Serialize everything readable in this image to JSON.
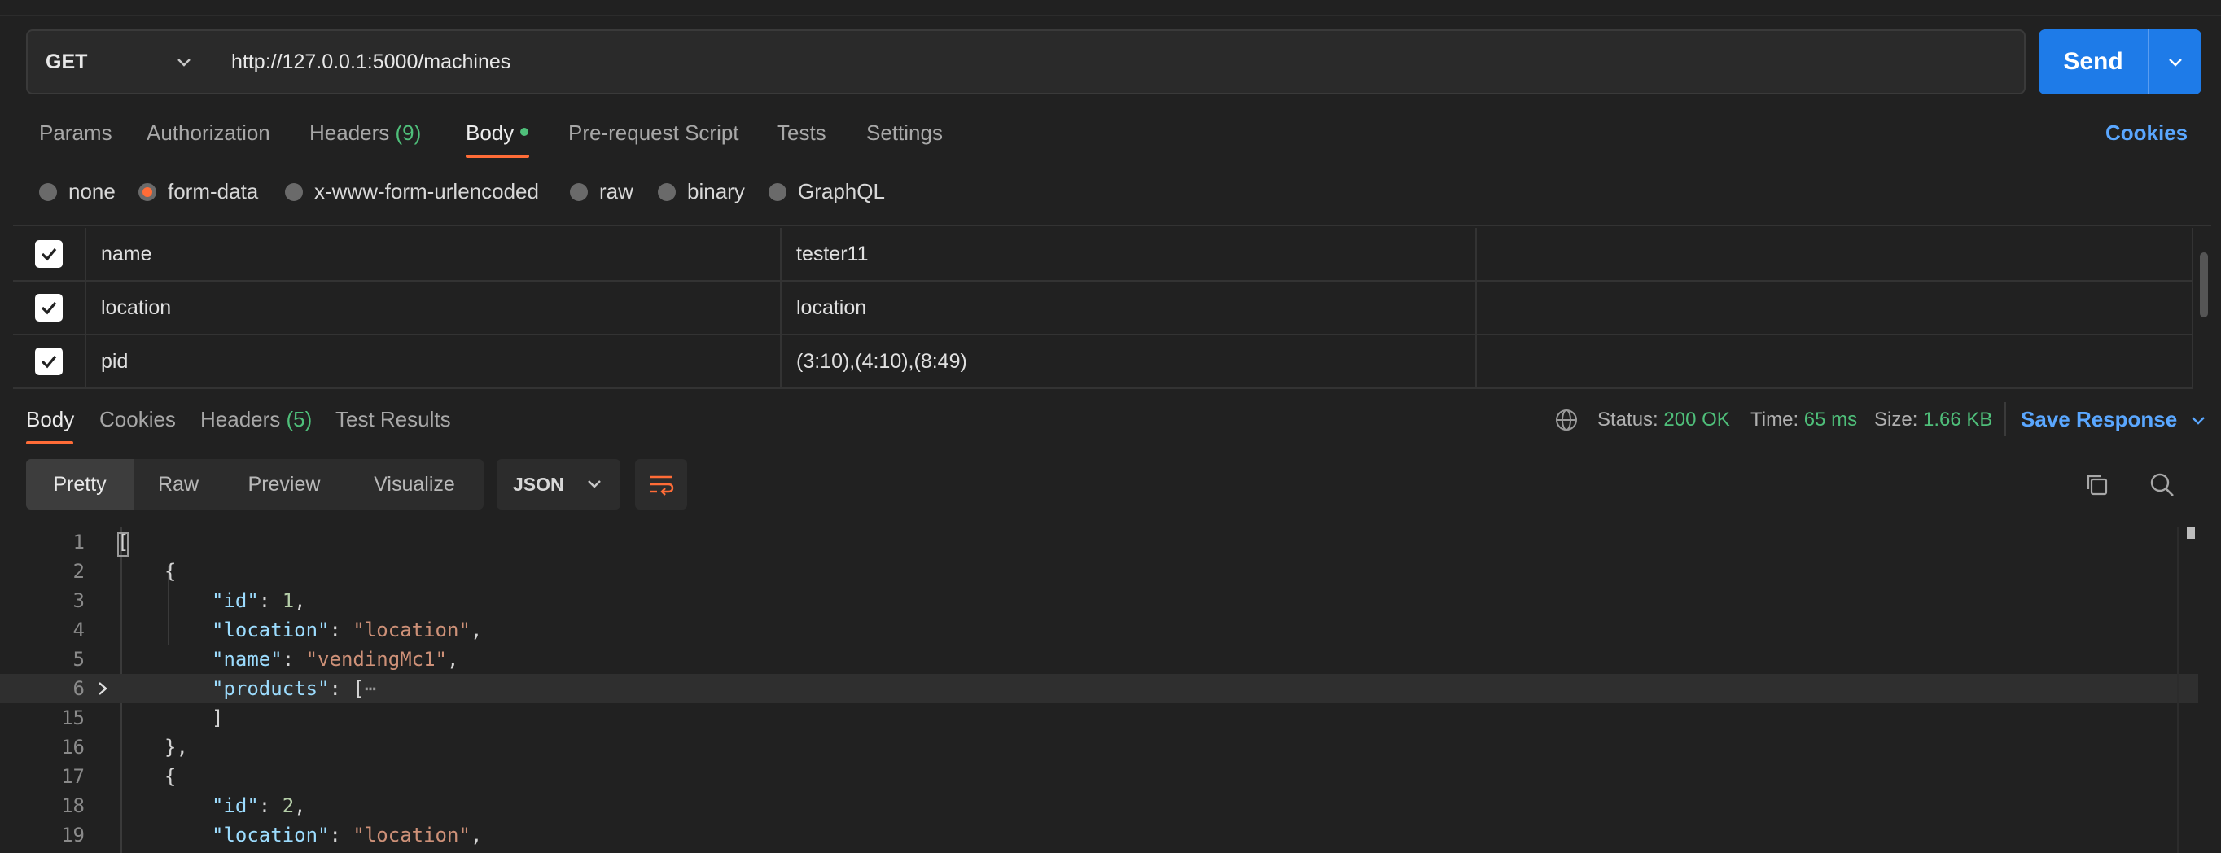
{
  "request": {
    "method": "GET",
    "url": "http://127.0.0.1:5000/machines",
    "send_label": "Send"
  },
  "request_tabs": [
    {
      "label": "Params"
    },
    {
      "label": "Authorization"
    },
    {
      "label": "Headers",
      "count": "(9)"
    },
    {
      "label": "Body"
    },
    {
      "label": "Pre-request Script"
    },
    {
      "label": "Tests"
    },
    {
      "label": "Settings"
    }
  ],
  "cookies_label": "Cookies",
  "body_types": [
    "none",
    "form-data",
    "x-www-form-urlencoded",
    "raw",
    "binary",
    "GraphQL"
  ],
  "form_rows": [
    {
      "key": "name",
      "value": "tester11"
    },
    {
      "key": "location",
      "value": "location"
    },
    {
      "key": "pid",
      "value": "(3:10),(4:10),(8:49)"
    }
  ],
  "response_tabs": [
    {
      "label": "Body"
    },
    {
      "label": "Cookies"
    },
    {
      "label": "Headers",
      "count": "(5)"
    },
    {
      "label": "Test Results"
    }
  ],
  "response_meta": {
    "status_label": "Status:",
    "status": "200 OK",
    "time_label": "Time:",
    "time": "65 ms",
    "size_label": "Size:",
    "size": "1.66 KB",
    "save_label": "Save Response"
  },
  "view_modes": [
    "Pretty",
    "Raw",
    "Preview",
    "Visualize"
  ],
  "format": "JSON",
  "code_lines": [
    {
      "n": "1",
      "text": "["
    },
    {
      "n": "2",
      "text": "{"
    },
    {
      "n": "3",
      "key": "\"id\"",
      "val": "1",
      "vtype": "n",
      "end": ","
    },
    {
      "n": "4",
      "key": "\"location\"",
      "val": "\"location\"",
      "vtype": "s",
      "end": ","
    },
    {
      "n": "5",
      "key": "\"name\"",
      "val": "\"vendingMc1\"",
      "vtype": "s",
      "end": ","
    },
    {
      "n": "6",
      "key": "\"products\"",
      "val": "[",
      "vtype": "p",
      "end": "",
      "fold": "⋯"
    },
    {
      "n": "15",
      "text": "]"
    },
    {
      "n": "16",
      "text": "},"
    },
    {
      "n": "17",
      "text": "{"
    },
    {
      "n": "18",
      "key": "\"id\"",
      "val": "2",
      "vtype": "n",
      "end": ","
    },
    {
      "n": "19",
      "key": "\"location\"",
      "val": "\"location\"",
      "vtype": "s",
      "end": ","
    }
  ]
}
